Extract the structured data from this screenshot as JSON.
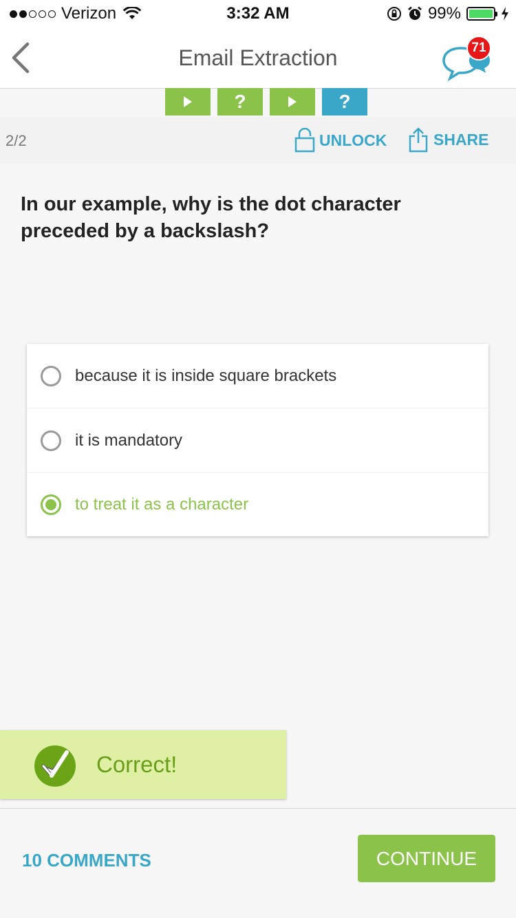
{
  "status_bar": {
    "carrier": "Verizon",
    "signal_filled": 2,
    "signal_total": 5,
    "time": "3:32 AM",
    "battery": "99%",
    "battery_level": 0.99
  },
  "nav": {
    "title": "Email Extraction",
    "chat_badge": "71",
    "accent_color": "#3aa7c9"
  },
  "progress_tabs": [
    {
      "icon": "play-icon",
      "glyph": "▶",
      "color": "#8bc34a"
    },
    {
      "icon": "question-icon",
      "glyph": "?",
      "color": "#8bc34a"
    },
    {
      "icon": "play-icon",
      "glyph": "▶",
      "color": "#8bc34a"
    },
    {
      "icon": "question-icon",
      "glyph": "?",
      "color": "#3aa7c9"
    }
  ],
  "sub_header": {
    "page_count": "2/2",
    "unlock_label": "UNLOCK",
    "share_label": "SHARE"
  },
  "question": {
    "text": "In our example, why is the dot character preceded by a backslash?"
  },
  "options": [
    {
      "label": "because it is inside square brackets",
      "selected": false
    },
    {
      "label": "it is mandatory",
      "selected": false
    },
    {
      "label": "to treat it as a character",
      "selected": true
    }
  ],
  "result": {
    "label": "Correct!",
    "color": "#6ba517"
  },
  "footer": {
    "comments_label": "10 COMMENTS",
    "continue_label": "CONTINUE"
  }
}
